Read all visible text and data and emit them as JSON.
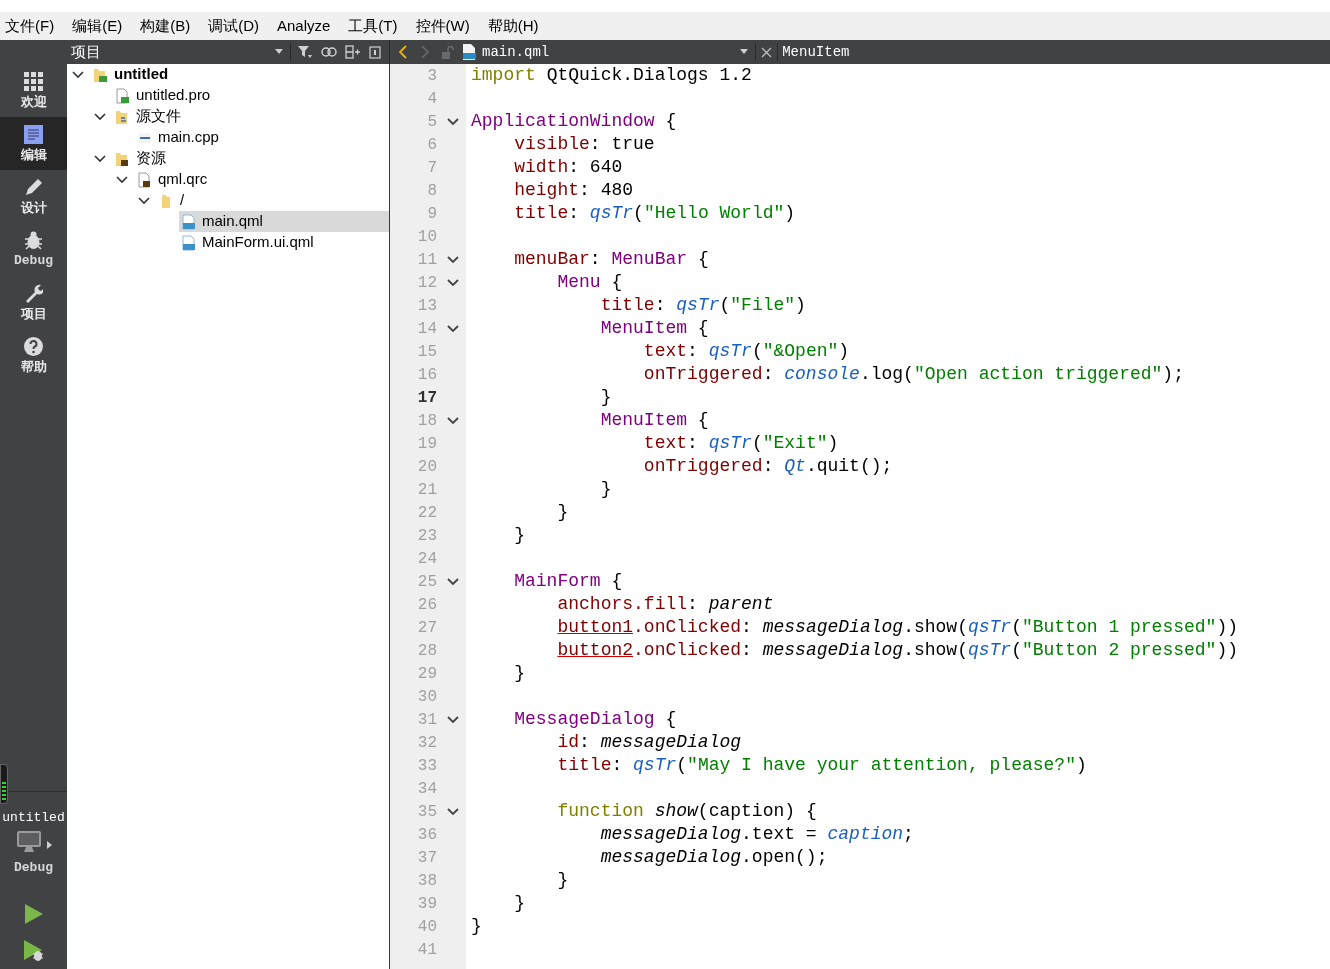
{
  "menu_bar": [
    "文件(F)",
    "编辑(E)",
    "构建(B)",
    "调试(D)",
    "Analyze",
    "工具(T)",
    "控件(W)",
    "帮助(H)"
  ],
  "mode_bar": [
    {
      "label": "欢迎",
      "kind": "welcome",
      "selected": false
    },
    {
      "label": "编辑",
      "kind": "edit",
      "selected": true
    },
    {
      "label": "设计",
      "kind": "design",
      "selected": false
    },
    {
      "label": "Debug",
      "kind": "debug",
      "selected": false
    },
    {
      "label": "项目",
      "kind": "projects",
      "selected": false
    },
    {
      "label": "帮助",
      "kind": "help",
      "selected": false
    }
  ],
  "target": {
    "project": "untitled",
    "config": "Debug"
  },
  "project_panel": {
    "title": "项目",
    "tree": [
      {
        "label": "untitled",
        "kind": "project",
        "expanded": true,
        "selected": false,
        "children": [
          {
            "label": "untitled.pro",
            "kind": "pro",
            "selected": false
          },
          {
            "label": "源文件",
            "kind": "folder-cpp",
            "expanded": true,
            "selected": false,
            "children": [
              {
                "label": "main.cpp",
                "kind": "cpp",
                "selected": false
              }
            ]
          },
          {
            "label": "资源",
            "kind": "folder-res",
            "expanded": true,
            "selected": false,
            "children": [
              {
                "label": "qml.qrc",
                "kind": "qrc",
                "expanded": true,
                "selected": false,
                "children": [
                  {
                    "label": "/",
                    "kind": "folder",
                    "expanded": true,
                    "selected": false,
                    "children": [
                      {
                        "label": "main.qml",
                        "kind": "qml",
                        "selected": true
                      },
                      {
                        "label": "MainForm.ui.qml",
                        "kind": "qml",
                        "selected": false
                      }
                    ]
                  }
                ]
              }
            ]
          }
        ]
      }
    ]
  },
  "editor": {
    "file": "main.qml",
    "symbol": "MenuItem",
    "lines": [
      {
        "n": "3",
        "fold": false,
        "current": false,
        "tokens": [
          {
            "kind": "keyword",
            "text": "import"
          },
          {
            "kind": "plain",
            "text": " QtQuick.Dialogs 1.2"
          }
        ]
      },
      {
        "n": "4",
        "fold": false,
        "current": false
      },
      {
        "n": "5",
        "fold": true,
        "current": false,
        "tokens": [
          {
            "kind": "type",
            "text": "ApplicationWindow"
          },
          {
            "kind": "plain",
            "text": " {"
          }
        ]
      },
      {
        "n": "6",
        "fold": false,
        "current": false,
        "tokens": [
          {
            "kind": "prop",
            "text": "    visible"
          },
          {
            "kind": "plain",
            "text": ": true"
          }
        ]
      },
      {
        "n": "7",
        "fold": false,
        "current": false,
        "tokens": [
          {
            "kind": "prop",
            "text": "    width"
          },
          {
            "kind": "plain",
            "text": ": 640"
          }
        ]
      },
      {
        "n": "8",
        "fold": false,
        "current": false,
        "tokens": [
          {
            "kind": "prop",
            "text": "    height"
          },
          {
            "kind": "plain",
            "text": ": 480"
          }
        ]
      },
      {
        "n": "9",
        "fold": false,
        "current": false,
        "tokens": [
          {
            "kind": "prop",
            "text": "    title"
          },
          {
            "kind": "plain",
            "text": ": "
          },
          {
            "kind": "func",
            "text": "qsTr"
          },
          {
            "kind": "plain",
            "text": "("
          },
          {
            "kind": "str",
            "text": "\"Hello World\""
          },
          {
            "kind": "plain",
            "text": ")"
          }
        ]
      },
      {
        "n": "10",
        "fold": false,
        "current": false
      },
      {
        "n": "11",
        "fold": true,
        "current": false,
        "tokens": [
          {
            "kind": "prop",
            "text": "    menuBar"
          },
          {
            "kind": "plain",
            "text": ": "
          },
          {
            "kind": "type",
            "text": "MenuBar"
          },
          {
            "kind": "plain",
            "text": " {"
          }
        ]
      },
      {
        "n": "12",
        "fold": true,
        "current": false,
        "tokens": [
          {
            "kind": "type",
            "text": "        Menu"
          },
          {
            "kind": "plain",
            "text": " {"
          }
        ]
      },
      {
        "n": "13",
        "fold": false,
        "current": false,
        "tokens": [
          {
            "kind": "prop",
            "text": "            title"
          },
          {
            "kind": "plain",
            "text": ": "
          },
          {
            "kind": "func",
            "text": "qsTr"
          },
          {
            "kind": "plain",
            "text": "("
          },
          {
            "kind": "str",
            "text": "\"File\""
          },
          {
            "kind": "plain",
            "text": ")"
          }
        ]
      },
      {
        "n": "14",
        "fold": true,
        "current": false,
        "tokens": [
          {
            "kind": "type",
            "text": "            MenuItem"
          },
          {
            "kind": "plain",
            "text": " {"
          }
        ]
      },
      {
        "n": "15",
        "fold": false,
        "current": false,
        "tokens": [
          {
            "kind": "prop",
            "text": "                text"
          },
          {
            "kind": "plain",
            "text": ": "
          },
          {
            "kind": "func",
            "text": "qsTr"
          },
          {
            "kind": "plain",
            "text": "("
          },
          {
            "kind": "str",
            "text": "\"&Open\""
          },
          {
            "kind": "plain",
            "text": ")"
          }
        ]
      },
      {
        "n": "16",
        "fold": false,
        "current": false,
        "tokens": [
          {
            "kind": "prop",
            "text": "                onTriggered"
          },
          {
            "kind": "plain",
            "text": ": "
          },
          {
            "kind": "func",
            "text": "console"
          },
          {
            "kind": "plain",
            "text": ".log("
          },
          {
            "kind": "str",
            "text": "\"Open action triggered\""
          },
          {
            "kind": "plain",
            "text": ");"
          }
        ]
      },
      {
        "n": "17",
        "fold": false,
        "current": true,
        "tokens": [
          {
            "kind": "plain",
            "text": "            }"
          }
        ]
      },
      {
        "n": "18",
        "fold": true,
        "current": false,
        "tokens": [
          {
            "kind": "type",
            "text": "            MenuItem"
          },
          {
            "kind": "plain",
            "text": " {"
          }
        ]
      },
      {
        "n": "19",
        "fold": false,
        "current": false,
        "tokens": [
          {
            "kind": "prop",
            "text": "                text"
          },
          {
            "kind": "plain",
            "text": ": "
          },
          {
            "kind": "func",
            "text": "qsTr"
          },
          {
            "kind": "plain",
            "text": "("
          },
          {
            "kind": "str",
            "text": "\"Exit\""
          },
          {
            "kind": "plain",
            "text": ")"
          }
        ]
      },
      {
        "n": "20",
        "fold": false,
        "current": false,
        "tokens": [
          {
            "kind": "prop",
            "text": "                onTriggered"
          },
          {
            "kind": "plain",
            "text": ": "
          },
          {
            "kind": "func",
            "text": "Qt"
          },
          {
            "kind": "plain",
            "text": ".quit();"
          }
        ]
      },
      {
        "n": "21",
        "fold": false,
        "current": false,
        "tokens": [
          {
            "kind": "plain",
            "text": "            }"
          }
        ]
      },
      {
        "n": "22",
        "fold": false,
        "current": false,
        "tokens": [
          {
            "kind": "plain",
            "text": "        }"
          }
        ]
      },
      {
        "n": "23",
        "fold": false,
        "current": false,
        "tokens": [
          {
            "kind": "plain",
            "text": "    }"
          }
        ]
      },
      {
        "n": "24",
        "fold": false,
        "current": false
      },
      {
        "n": "25",
        "fold": true,
        "current": false,
        "tokens": [
          {
            "kind": "type",
            "text": "    MainForm"
          },
          {
            "kind": "plain",
            "text": " {"
          }
        ]
      },
      {
        "n": "26",
        "fold": false,
        "current": false,
        "tokens": [
          {
            "kind": "prop",
            "text": "        anchors.fill"
          },
          {
            "kind": "plain",
            "text": ": "
          },
          {
            "kind": "ital",
            "text": "parent"
          }
        ]
      },
      {
        "n": "27",
        "fold": false,
        "current": false,
        "tokens": [
          {
            "kind": "link",
            "text": "        button1"
          },
          {
            "kind": "prop",
            "text": ".onClicked"
          },
          {
            "kind": "plain",
            "text": ": "
          },
          {
            "kind": "ital",
            "text": "messageDialog"
          },
          {
            "kind": "plain",
            "text": ".show("
          },
          {
            "kind": "func",
            "text": "qsTr"
          },
          {
            "kind": "plain",
            "text": "("
          },
          {
            "kind": "str",
            "text": "\"Button 1 pressed\""
          },
          {
            "kind": "plain",
            "text": "))"
          }
        ]
      },
      {
        "n": "28",
        "fold": false,
        "current": false,
        "tokens": [
          {
            "kind": "link",
            "text": "        button2"
          },
          {
            "kind": "prop",
            "text": ".onClicked"
          },
          {
            "kind": "plain",
            "text": ": "
          },
          {
            "kind": "ital",
            "text": "messageDialog"
          },
          {
            "kind": "plain",
            "text": ".show("
          },
          {
            "kind": "func",
            "text": "qsTr"
          },
          {
            "kind": "plain",
            "text": "("
          },
          {
            "kind": "str",
            "text": "\"Button 2 pressed\""
          },
          {
            "kind": "plain",
            "text": "))"
          }
        ]
      },
      {
        "n": "29",
        "fold": false,
        "current": false,
        "tokens": [
          {
            "kind": "plain",
            "text": "    }"
          }
        ]
      },
      {
        "n": "30",
        "fold": false,
        "current": false
      },
      {
        "n": "31",
        "fold": true,
        "current": false,
        "tokens": [
          {
            "kind": "type",
            "text": "    MessageDialog"
          },
          {
            "kind": "plain",
            "text": " {"
          }
        ]
      },
      {
        "n": "32",
        "fold": false,
        "current": false,
        "tokens": [
          {
            "kind": "prop",
            "text": "        id"
          },
          {
            "kind": "plain",
            "text": ": "
          },
          {
            "kind": "ital",
            "text": "messageDialog"
          }
        ]
      },
      {
        "n": "33",
        "fold": false,
        "current": false,
        "tokens": [
          {
            "kind": "prop",
            "text": "        title"
          },
          {
            "kind": "plain",
            "text": ": "
          },
          {
            "kind": "func",
            "text": "qsTr"
          },
          {
            "kind": "plain",
            "text": "("
          },
          {
            "kind": "str",
            "text": "\"May I have your attention, please?\""
          },
          {
            "kind": "plain",
            "text": ")"
          }
        ]
      },
      {
        "n": "34",
        "fold": false,
        "current": false
      },
      {
        "n": "35",
        "fold": true,
        "current": false,
        "tokens": [
          {
            "kind": "keyword",
            "text": "        function "
          },
          {
            "kind": "ital",
            "text": "show"
          },
          {
            "kind": "plain",
            "text": "(caption) {"
          }
        ]
      },
      {
        "n": "36",
        "fold": false,
        "current": false,
        "tokens": [
          {
            "kind": "ital",
            "text": "            messageDialog"
          },
          {
            "kind": "plain",
            "text": ".text = "
          },
          {
            "kind": "func",
            "text": "caption"
          },
          {
            "kind": "plain",
            "text": ";"
          }
        ]
      },
      {
        "n": "37",
        "fold": false,
        "current": false,
        "tokens": [
          {
            "kind": "ital",
            "text": "            messageDialog"
          },
          {
            "kind": "plain",
            "text": ".open();"
          }
        ]
      },
      {
        "n": "38",
        "fold": false,
        "current": false,
        "tokens": [
          {
            "kind": "plain",
            "text": "        }"
          }
        ]
      },
      {
        "n": "39",
        "fold": false,
        "current": false,
        "tokens": [
          {
            "kind": "plain",
            "text": "    }"
          }
        ]
      },
      {
        "n": "40",
        "fold": false,
        "current": false,
        "tokens": [
          {
            "kind": "plain",
            "text": "}"
          }
        ]
      },
      {
        "n": "41",
        "fold": false,
        "current": false
      }
    ]
  }
}
